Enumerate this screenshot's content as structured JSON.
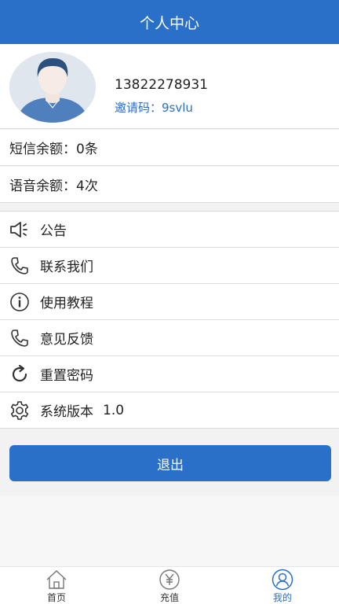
{
  "header": {
    "title": "个人中心"
  },
  "profile": {
    "phone": "13822278931",
    "invite_label": "邀请码：",
    "invite_code": "9svlu"
  },
  "balances": {
    "sms": "短信余额：0条",
    "voice": "语音余额：4次"
  },
  "menu": {
    "items": [
      {
        "label": "公告",
        "icon": "speaker-icon"
      },
      {
        "label": "联系我们",
        "icon": "phone-icon"
      },
      {
        "label": "使用教程",
        "icon": "info-icon"
      },
      {
        "label": "意见反馈",
        "icon": "phone-icon"
      },
      {
        "label": "重置密码",
        "icon": "refresh-icon"
      },
      {
        "label": "系统版本",
        "icon": "gear-icon",
        "value": "1.0"
      }
    ]
  },
  "logout": {
    "label": "退出"
  },
  "tabbar": {
    "tabs": [
      {
        "label": "首页",
        "icon": "home-icon",
        "active": false
      },
      {
        "label": "充值",
        "icon": "yen-icon",
        "active": false
      },
      {
        "label": "我的",
        "icon": "user-icon",
        "active": true
      }
    ]
  },
  "colors": {
    "primary": "#2a70c9",
    "background": "#f2f2f2"
  }
}
